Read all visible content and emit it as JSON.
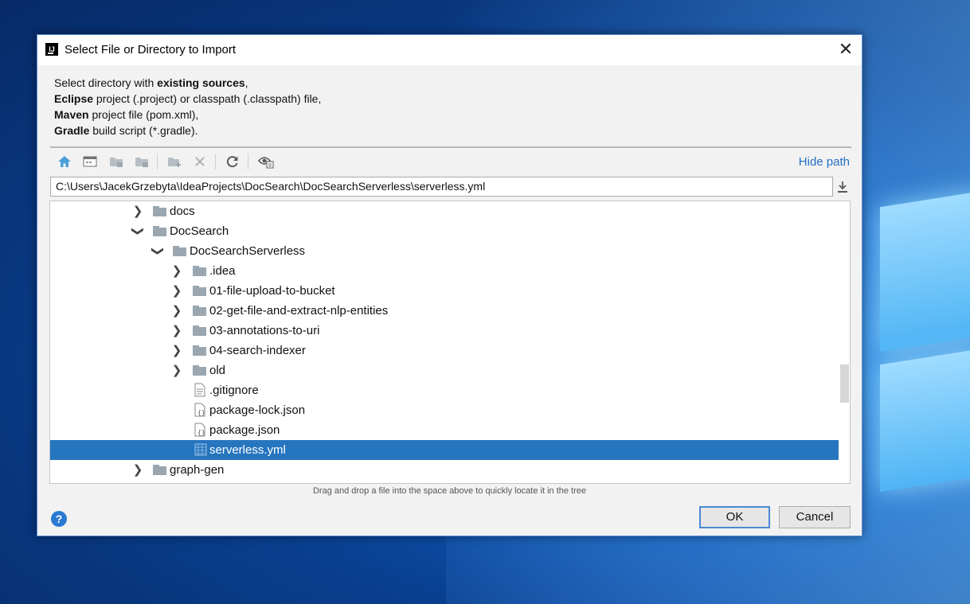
{
  "dialog": {
    "title": "Select File or Directory to Import",
    "close_symbol": "✕"
  },
  "description": {
    "line1_pre": "Select directory with ",
    "line1_bold": "existing sources",
    "line1_post": ",",
    "line2_bold": "Eclipse",
    "line2_post": " project (.project) or classpath (.classpath) file,",
    "line3_bold": "Maven",
    "line3_post": " project file (pom.xml),",
    "line4_bold": "Gradle",
    "line4_post": " build script (*.gradle)."
  },
  "toolbar": {
    "icons": [
      "home-icon",
      "desktop-icon",
      "project-folder-icon",
      "module-folder-icon",
      "new-folder-icon",
      "delete-icon",
      "refresh-icon",
      "show-hidden-icon"
    ],
    "hide_path_label": "Hide path"
  },
  "path": {
    "value": "C:\\Users\\JacekGrzebyta\\IdeaProjects\\DocSearch\\DocSearchServerless\\serverless.yml"
  },
  "tree": {
    "items": [
      {
        "label": "docs",
        "type": "folder",
        "expanded": false
      },
      {
        "label": "DocSearch",
        "type": "folder",
        "expanded": true
      },
      {
        "label": "DocSearchServerless",
        "type": "folder",
        "expanded": true
      },
      {
        "label": ".idea",
        "type": "folder",
        "expanded": false
      },
      {
        "label": "01-file-upload-to-bucket",
        "type": "folder",
        "expanded": false
      },
      {
        "label": "02-get-file-and-extract-nlp-entities",
        "type": "folder",
        "expanded": false
      },
      {
        "label": "03-annotations-to-uri",
        "type": "folder",
        "expanded": false
      },
      {
        "label": "04-search-indexer",
        "type": "folder",
        "expanded": false
      },
      {
        "label": "old",
        "type": "folder",
        "expanded": false
      },
      {
        "label": ".gitignore",
        "type": "text-file"
      },
      {
        "label": "package-lock.json",
        "type": "json-file"
      },
      {
        "label": "package.json",
        "type": "json-file"
      },
      {
        "label": "serverless.yml",
        "type": "yml-file",
        "selected": true
      },
      {
        "label": "graph-gen",
        "type": "folder",
        "expanded": false
      }
    ]
  },
  "hint": "Drag and drop a file into the space above to quickly locate it in the tree",
  "buttons": {
    "help_symbol": "?",
    "ok_label": "OK",
    "cancel_label": "Cancel"
  },
  "colors": {
    "selection": "#2675bf",
    "link": "#2470c2",
    "folder": "#9aa7b0"
  }
}
